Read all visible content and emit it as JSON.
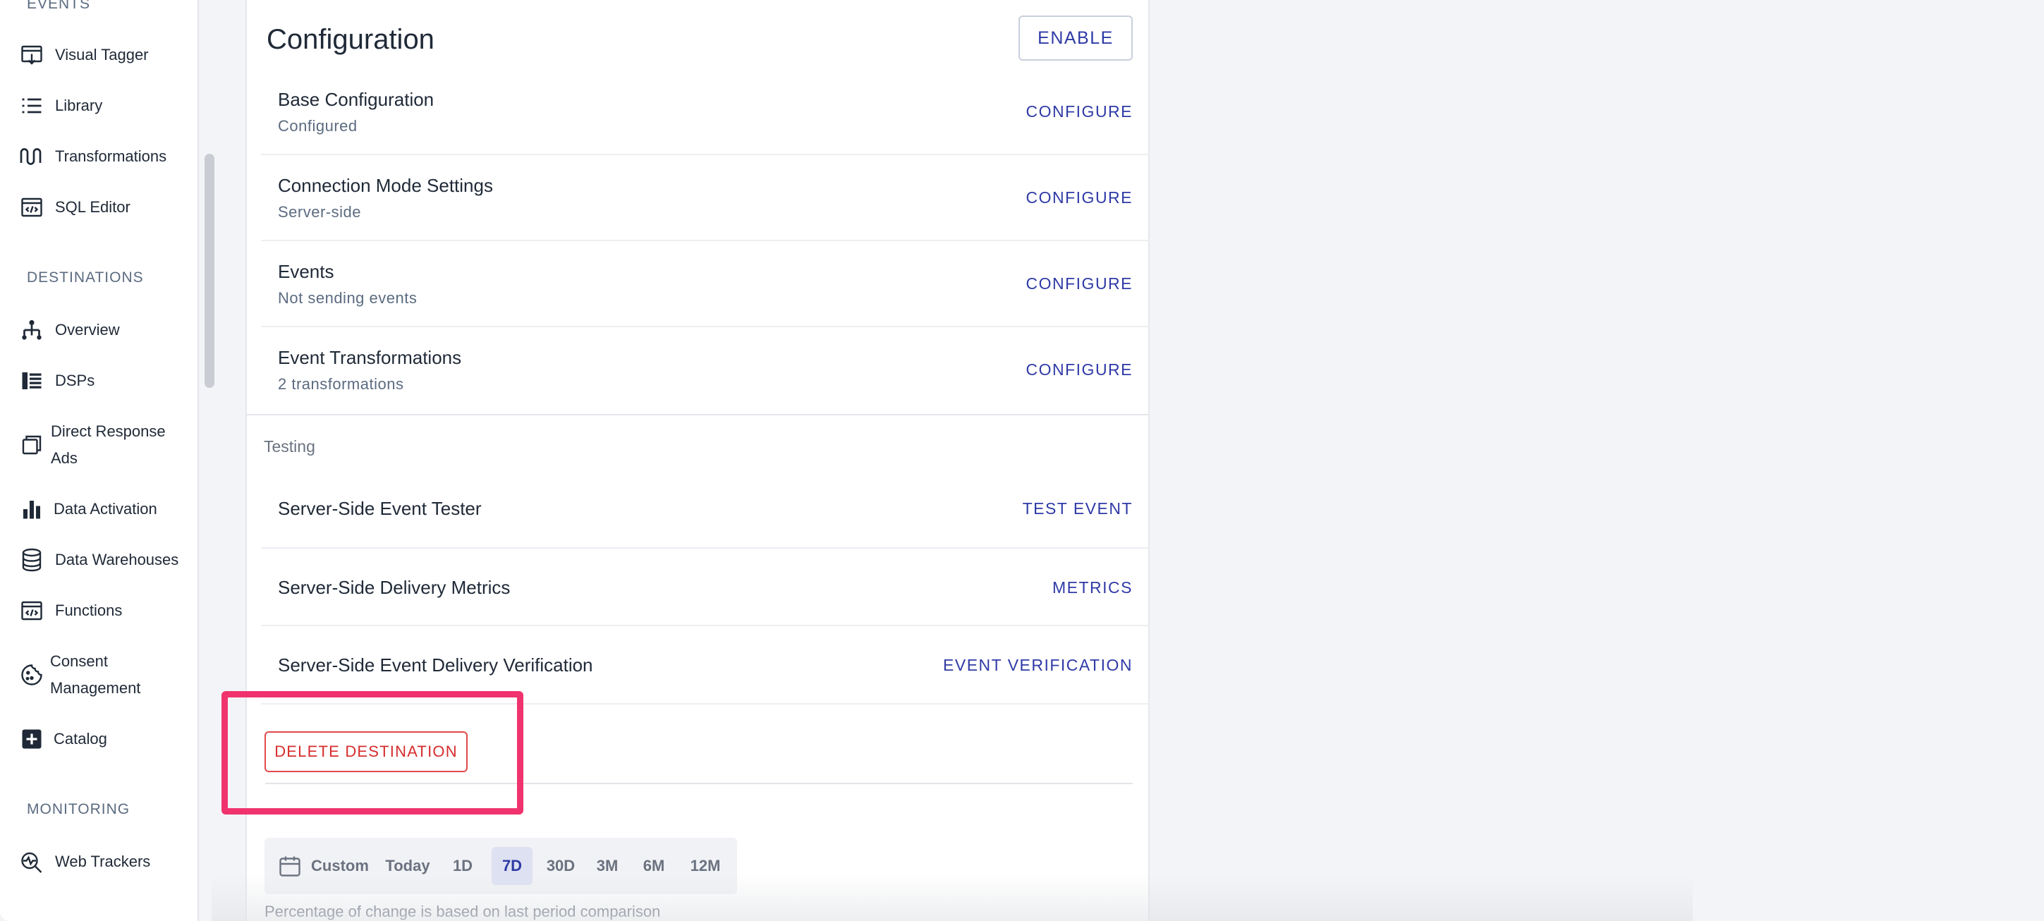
{
  "sidebar": {
    "events_heading": "EVENTS",
    "events_items": [
      {
        "label": "Visual Tagger",
        "icon": "visual-tagger-icon"
      },
      {
        "label": "Library",
        "icon": "library-list-icon"
      },
      {
        "label": "Transformations",
        "icon": "transformations-wave-icon"
      },
      {
        "label": "SQL Editor",
        "icon": "sql-editor-icon"
      }
    ],
    "destinations_heading": "DESTINATIONS",
    "destinations_items": [
      {
        "label": "Overview",
        "icon": "overview-tree-icon"
      },
      {
        "label": "DSPs",
        "icon": "dsps-icon"
      },
      {
        "label": "Direct Response Ads",
        "icon": "direct-response-ads-icon"
      },
      {
        "label": "Data Activation",
        "icon": "bar-chart-icon"
      },
      {
        "label": "Data Warehouses",
        "icon": "database-icon"
      },
      {
        "label": "Functions",
        "icon": "functions-code-icon"
      },
      {
        "label": "Consent Management",
        "icon": "cookie-icon"
      },
      {
        "label": "Catalog",
        "icon": "plus-square-icon"
      }
    ],
    "monitoring_heading": "MONITORING",
    "monitoring_items": [
      {
        "label": "Web Trackers",
        "icon": "web-trackers-icon"
      }
    ]
  },
  "configuration": {
    "title": "Configuration",
    "enable_label": "ENABLE",
    "rows": [
      {
        "title": "Base Configuration",
        "subtitle": "Configured",
        "action": "CONFIGURE"
      },
      {
        "title": "Connection Mode Settings",
        "subtitle": "Server-side",
        "action": "CONFIGURE"
      },
      {
        "title": "Events",
        "subtitle": "Not sending events",
        "action": "CONFIGURE"
      },
      {
        "title": "Event Transformations",
        "subtitle": "2 transformations",
        "action": "CONFIGURE"
      }
    ]
  },
  "testing": {
    "label": "Testing",
    "rows": [
      {
        "title": "Server-Side Event Tester",
        "action": "TEST EVENT"
      },
      {
        "title": "Server-Side Delivery Metrics",
        "action": "METRICS"
      },
      {
        "title": "Server-Side Event Delivery Verification",
        "action": "EVENT VERIFICATION"
      }
    ]
  },
  "delete_label": "DELETE DESTINATION",
  "date_range": {
    "icon": "calendar-icon",
    "options": [
      "Custom",
      "Today",
      "1D",
      "7D",
      "30D",
      "3M",
      "6M",
      "12M"
    ],
    "selected": "7D"
  },
  "footnote": "Percentage of change is based on last period comparison",
  "colors": {
    "accent": "#2f3aa6",
    "danger": "#d62d2d",
    "highlight": "#f0336e"
  }
}
